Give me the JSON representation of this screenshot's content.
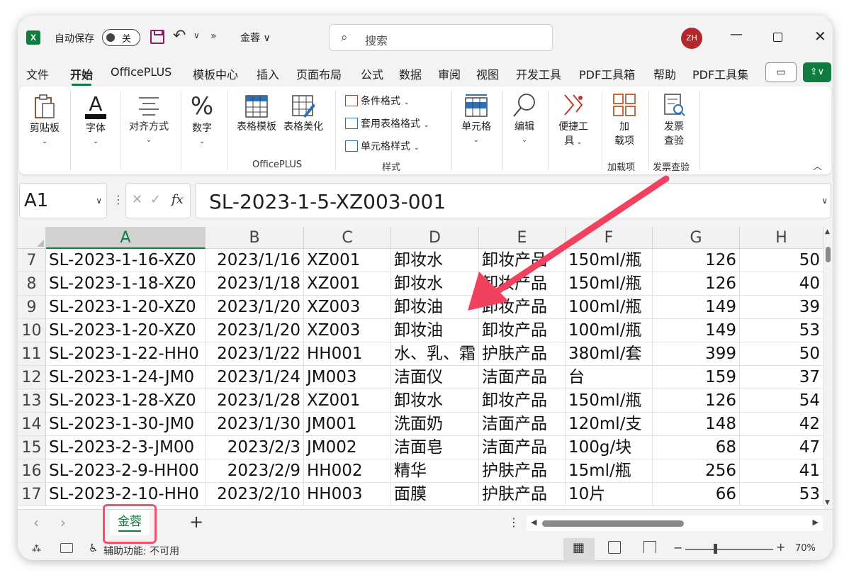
{
  "titlebar": {
    "autosave_label": "自动保存",
    "autosave_state": "关",
    "doc_name": "金蓉 ∨",
    "search_placeholder": "搜索",
    "avatar_initials": "ZH"
  },
  "menu": {
    "tabs": [
      "文件",
      "开始",
      "OfficePLUS",
      "模板中心",
      "插入",
      "页面布局",
      "公式",
      "数据",
      "审阅",
      "视图",
      "开发工具",
      "PDF工具箱",
      "帮助",
      "PDF工具集"
    ],
    "active_tab": "开始"
  },
  "ribbon": {
    "clipboard": "剪贴板",
    "font": "字体",
    "alignment": "对齐方式",
    "number": "数字",
    "table_template": "表格模板",
    "table_beautify": "表格美化",
    "officeplus_group": "OfficePLUS",
    "conditional_format": "条件格式",
    "table_format": "套用表格格式",
    "cell_styles": "单元格样式",
    "styles_group": "样式",
    "cells": "单元格",
    "editing": "编辑",
    "quick_tools_1": "便捷工",
    "quick_tools_2": "具",
    "addins_1": "加",
    "addins_2": "载项",
    "addins_group": "加载项",
    "invoice_1": "发票",
    "invoice_2": "查验",
    "invoice_group": "发票查验"
  },
  "formula_bar": {
    "name_box": "A1",
    "formula_value": "SL-2023-1-5-XZ003-001"
  },
  "grid": {
    "columns": [
      "A",
      "B",
      "C",
      "D",
      "E",
      "F",
      "G",
      "H"
    ],
    "selected_column": "A",
    "rows": [
      {
        "num": "7",
        "cells": [
          "SL-2023-1-16-XZ0",
          "2023/1/16",
          "XZ001",
          "卸妆水",
          "卸妆产品",
          "150ml/瓶",
          "126",
          "50"
        ]
      },
      {
        "num": "8",
        "cells": [
          "SL-2023-1-18-XZ0",
          "2023/1/18",
          "XZ001",
          "卸妆水",
          "卸妆产品",
          "150ml/瓶",
          "126",
          "40"
        ]
      },
      {
        "num": "9",
        "cells": [
          "SL-2023-1-20-XZ0",
          "2023/1/20",
          "XZ003",
          "卸妆油",
          "卸妆产品",
          "100ml/瓶",
          "149",
          "39"
        ]
      },
      {
        "num": "10",
        "cells": [
          "SL-2023-1-20-XZ0",
          "2023/1/20",
          "XZ003",
          "卸妆油",
          "卸妆产品",
          "100ml/瓶",
          "149",
          "53"
        ]
      },
      {
        "num": "11",
        "cells": [
          "SL-2023-1-22-HH0",
          "2023/1/22",
          "HH001",
          "水、乳、霜",
          "护肤产品",
          "380ml/套",
          "399",
          "50"
        ]
      },
      {
        "num": "12",
        "cells": [
          "SL-2023-1-24-JM0",
          "2023/1/24",
          "JM003",
          "洁面仪",
          "洁面产品",
          "台",
          "159",
          "37"
        ]
      },
      {
        "num": "13",
        "cells": [
          "SL-2023-1-28-XZ0",
          "2023/1/28",
          "XZ001",
          "卸妆水",
          "卸妆产品",
          "150ml/瓶",
          "126",
          "54"
        ]
      },
      {
        "num": "14",
        "cells": [
          "SL-2023-1-30-JM0",
          "2023/1/30",
          "JM001",
          "洗面奶",
          "洁面产品",
          "120ml/支",
          "148",
          "42"
        ]
      },
      {
        "num": "15",
        "cells": [
          "SL-2023-2-3-JM00",
          "2023/2/3",
          "JM002",
          "洁面皂",
          "洁面产品",
          "100g/块",
          "68",
          "47"
        ]
      },
      {
        "num": "16",
        "cells": [
          "SL-2023-2-9-HH00",
          "2023/2/9",
          "HH002",
          "精华",
          "护肤产品",
          "15ml/瓶",
          "256",
          "41"
        ]
      },
      {
        "num": "17",
        "cells": [
          "SL-2023-2-10-HH0",
          "2023/2/10",
          "HH003",
          "面膜",
          "护肤产品",
          "10片",
          "66",
          "53"
        ]
      }
    ]
  },
  "sheets": {
    "active": "金蓉",
    "add_label": "+"
  },
  "statusbar": {
    "accessibility": "辅助功能: 不可用",
    "zoom": "70%"
  },
  "colors": {
    "accent": "#107c41",
    "annotation": "#ff4d6d",
    "avatar": "#b3262a"
  }
}
